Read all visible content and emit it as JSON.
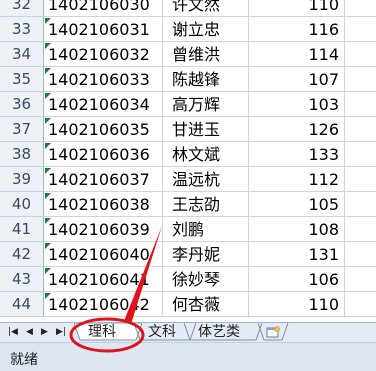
{
  "rows": [
    {
      "n": "32",
      "id": "1402106030",
      "name": "许文然",
      "score": "110"
    },
    {
      "n": "33",
      "id": "1402106031",
      "name": "谢立忠",
      "score": "116"
    },
    {
      "n": "34",
      "id": "1402106032",
      "name": "曾维洪",
      "score": "114"
    },
    {
      "n": "35",
      "id": "1402106033",
      "name": "陈越锋",
      "score": "107"
    },
    {
      "n": "36",
      "id": "1402106034",
      "name": "高万辉",
      "score": "103"
    },
    {
      "n": "37",
      "id": "1402106035",
      "name": "甘进玉",
      "score": "126"
    },
    {
      "n": "38",
      "id": "1402106036",
      "name": "林文斌",
      "score": "133"
    },
    {
      "n": "39",
      "id": "1402106037",
      "name": "温远杭",
      "score": "112"
    },
    {
      "n": "40",
      "id": "1402106038",
      "name": "王志劭",
      "score": "105"
    },
    {
      "n": "41",
      "id": "1402106039",
      "name": "刘鹏",
      "score": "108"
    },
    {
      "n": "42",
      "id": "1402106040",
      "name": "李丹妮",
      "score": "131"
    },
    {
      "n": "43",
      "id": "1402106041",
      "name": "徐妙琴",
      "score": "106"
    },
    {
      "n": "44",
      "id": "1402106042",
      "name": "何杏薇",
      "score": "110"
    }
  ],
  "tabs": {
    "nav": [
      "|◀",
      "◀",
      "▶",
      "▶|"
    ],
    "sheet1": "理科",
    "sheet2": "文科",
    "sheet3": "体艺类"
  },
  "status": "就绪",
  "colors": {
    "highlight": "#e0121b",
    "row_header_bg": "#eef1f6",
    "tab_bar_bg": "#e4ebf4"
  }
}
